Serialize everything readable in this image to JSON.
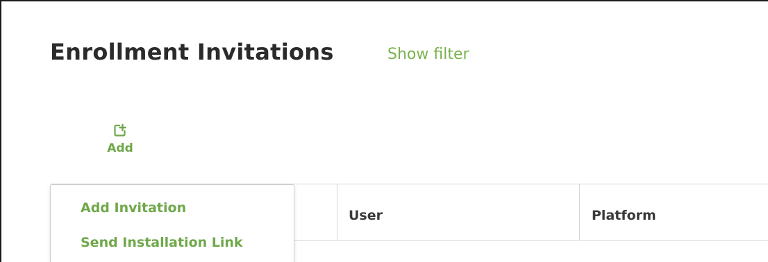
{
  "header": {
    "title": "Enrollment Invitations",
    "show_filter": "Show filter"
  },
  "toolbar": {
    "add_label": "Add",
    "add_icon": "add-document-icon"
  },
  "table": {
    "columns": [
      "User",
      "Platform"
    ]
  },
  "add_menu": {
    "items": [
      "Add Invitation",
      "Send Installation Link"
    ]
  },
  "colors": {
    "accent": "#7ab24e",
    "title": "#2b2b2b"
  }
}
